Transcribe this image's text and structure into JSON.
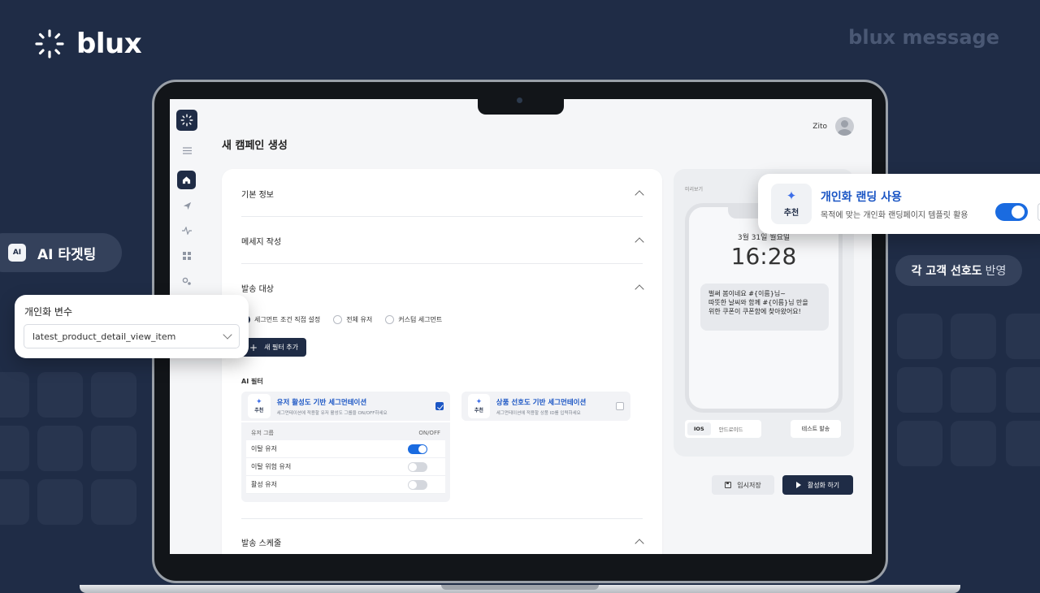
{
  "brand": {
    "name": "blux",
    "product": "blux message"
  },
  "badges": {
    "ai_chip": "AI",
    "ai_targeting": "AI 타겟팅",
    "preference_bold": "각 고객 선호도",
    "preference_light": "반영"
  },
  "personal_variable": {
    "title": "개인화 변수",
    "selected": "latest_product_detail_view_item"
  },
  "landing_card": {
    "badge": "추천",
    "title": "개인화 랜딩 사용",
    "description": "목적에 맞는 개인화 랜딩페이지 템플릿 활용",
    "enabled": true
  },
  "app": {
    "page_title": "새 캠페인 생성",
    "user_name": "Zito",
    "sections": {
      "basic_info": "기본 정보",
      "message": "메세지 작성",
      "target": "발송 대상",
      "schedule": "발송 스케줄"
    },
    "target_options": [
      {
        "label": "세그먼트 조건 직접 설정",
        "selected": true
      },
      {
        "label": "전체 유저",
        "selected": false
      },
      {
        "label": "커스텀 세그먼트",
        "selected": false
      }
    ],
    "add_filter": "새 필터 추가",
    "ai_filter_label": "AI 필터",
    "segments": [
      {
        "badge": "추천",
        "title": "유저 활성도 기반 세그먼테이션",
        "desc": "세그먼테이션에 적용할 유저 활성도 그룹을 ON/OFF하세요",
        "checked": true
      },
      {
        "badge": "추천",
        "title": "상품 선호도 기반 세그먼테이션",
        "desc": "세그먼테이션에 적용할 상품 ID를 입력하세요",
        "checked": false
      }
    ],
    "user_table": {
      "col_group": "유저 그룹",
      "col_onoff": "ON/OFF",
      "rows": [
        {
          "name": "이탈 유저",
          "on": true
        },
        {
          "name": "이탈 위험 유저",
          "on": false
        },
        {
          "name": "활성 유저",
          "on": false
        }
      ]
    },
    "preview": {
      "label": "미리보기",
      "date": "3월 31일 월요일",
      "time": "16:28",
      "notif_line1": "벌써 봄이네요 #{이름}님~",
      "notif_line2": "따뜻한 날씨와 함께 #{이름}님 만을",
      "notif_line3": "위한 쿠폰이 쿠폰함에 찾아왔어요!",
      "os_ios": "IOS",
      "os_android": "안드로이드",
      "test_send": "테스트 발송"
    },
    "buttons": {
      "save": "임시저장",
      "activate": "활성화 하기"
    }
  }
}
